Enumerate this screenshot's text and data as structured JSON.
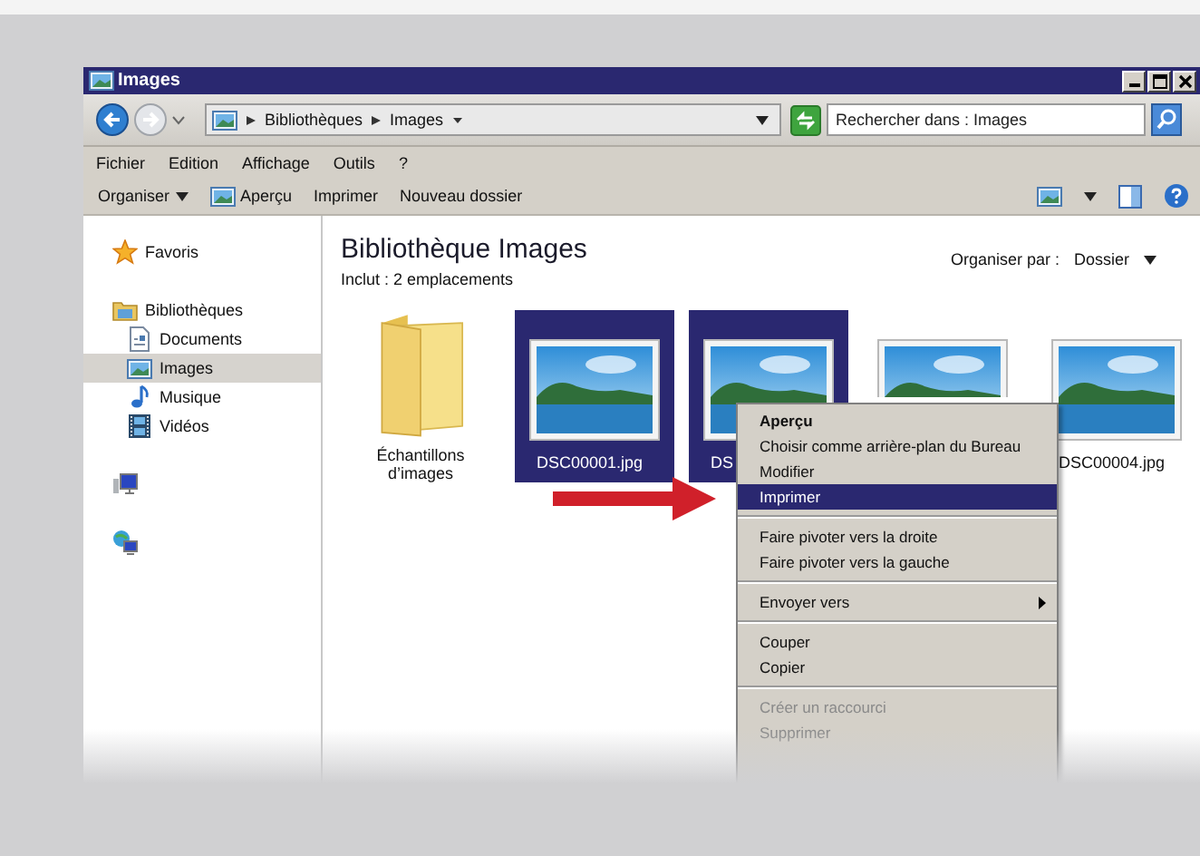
{
  "window": {
    "title": "Images"
  },
  "address_bar": {
    "path": [
      "Bibliothèques",
      "Images"
    ],
    "search": {
      "placeholder": "Rechercher dans : Images"
    }
  },
  "menu_bar": [
    "Fichier",
    "Edition",
    "Affichage",
    "Outils",
    "?"
  ],
  "toolbar": [
    {
      "kind": "dropdown",
      "label": "Organiser"
    },
    {
      "kind": "icon",
      "label": "Aperçu"
    },
    {
      "kind": "plain",
      "label": "Imprimer"
    },
    {
      "kind": "plain",
      "label": "Nouveau dossier"
    }
  ],
  "sidebar": {
    "items": [
      {
        "kind": "star",
        "label": "Favoris",
        "selected": false
      },
      {
        "kind": "library",
        "label": "Bibliothèques",
        "selected": false,
        "children": [
          {
            "kind": "document",
            "label": "Documents",
            "selected": false
          },
          {
            "kind": "image",
            "label": "Images",
            "selected": true
          },
          {
            "kind": "music",
            "label": "Musique",
            "selected": false
          },
          {
            "kind": "video",
            "label": "Vidéos",
            "selected": false
          }
        ]
      },
      {
        "kind": "computer",
        "selected": false
      },
      {
        "kind": "network",
        "selected": false
      }
    ]
  },
  "library": {
    "title": "Bibliothèque Images",
    "subtitle": "Inclut :  2 emplacements",
    "arrange_label": "Organiser par :",
    "arrange_value": "Dossier"
  },
  "files": [
    {
      "kind": "folder",
      "name": "Échantillons d’images",
      "selected": false
    },
    {
      "kind": "image",
      "name": "DSC00001.jpg",
      "selected": true
    },
    {
      "kind": "image",
      "name": "DS",
      "selected": true
    },
    {
      "kind": "image",
      "selected": false
    },
    {
      "kind": "image",
      "name": "DSC00004.jpg",
      "selected": false
    }
  ],
  "context_menu": [
    {
      "kind": "item",
      "label": "Aperçu",
      "default": true,
      "selected": false,
      "disabled": false,
      "submenu": false
    },
    {
      "kind": "item",
      "label": "Choisir comme arrière-plan du Bureau",
      "default": false,
      "selected": false,
      "disabled": false,
      "submenu": false
    },
    {
      "kind": "item",
      "label": "Modifier",
      "default": false,
      "selected": false,
      "disabled": false,
      "submenu": false
    },
    {
      "kind": "item",
      "label": "Imprimer",
      "default": false,
      "selected": true,
      "disabled": false,
      "submenu": false
    },
    {
      "kind": "separator"
    },
    {
      "kind": "item",
      "label": "Faire pivoter vers la droite",
      "default": false,
      "selected": false,
      "disabled": false,
      "submenu": false
    },
    {
      "kind": "item",
      "label": "Faire pivoter vers la gauche",
      "default": false,
      "selected": false,
      "disabled": false,
      "submenu": false
    },
    {
      "kind": "separator"
    },
    {
      "kind": "item",
      "label": "Envoyer vers",
      "default": false,
      "selected": false,
      "disabled": false,
      "submenu": true
    },
    {
      "kind": "separator"
    },
    {
      "kind": "item",
      "label": "Couper",
      "default": false,
      "selected": false,
      "disabled": false,
      "submenu": false
    },
    {
      "kind": "item",
      "label": "Copier",
      "default": false,
      "selected": false,
      "disabled": false,
      "submenu": false
    },
    {
      "kind": "separator"
    },
    {
      "kind": "item",
      "label": "Créer un raccourci",
      "default": false,
      "selected": false,
      "disabled": true,
      "submenu": false
    },
    {
      "kind": "item",
      "label": "Supprimer",
      "default": false,
      "selected": false,
      "disabled": true,
      "submenu": false
    }
  ]
}
